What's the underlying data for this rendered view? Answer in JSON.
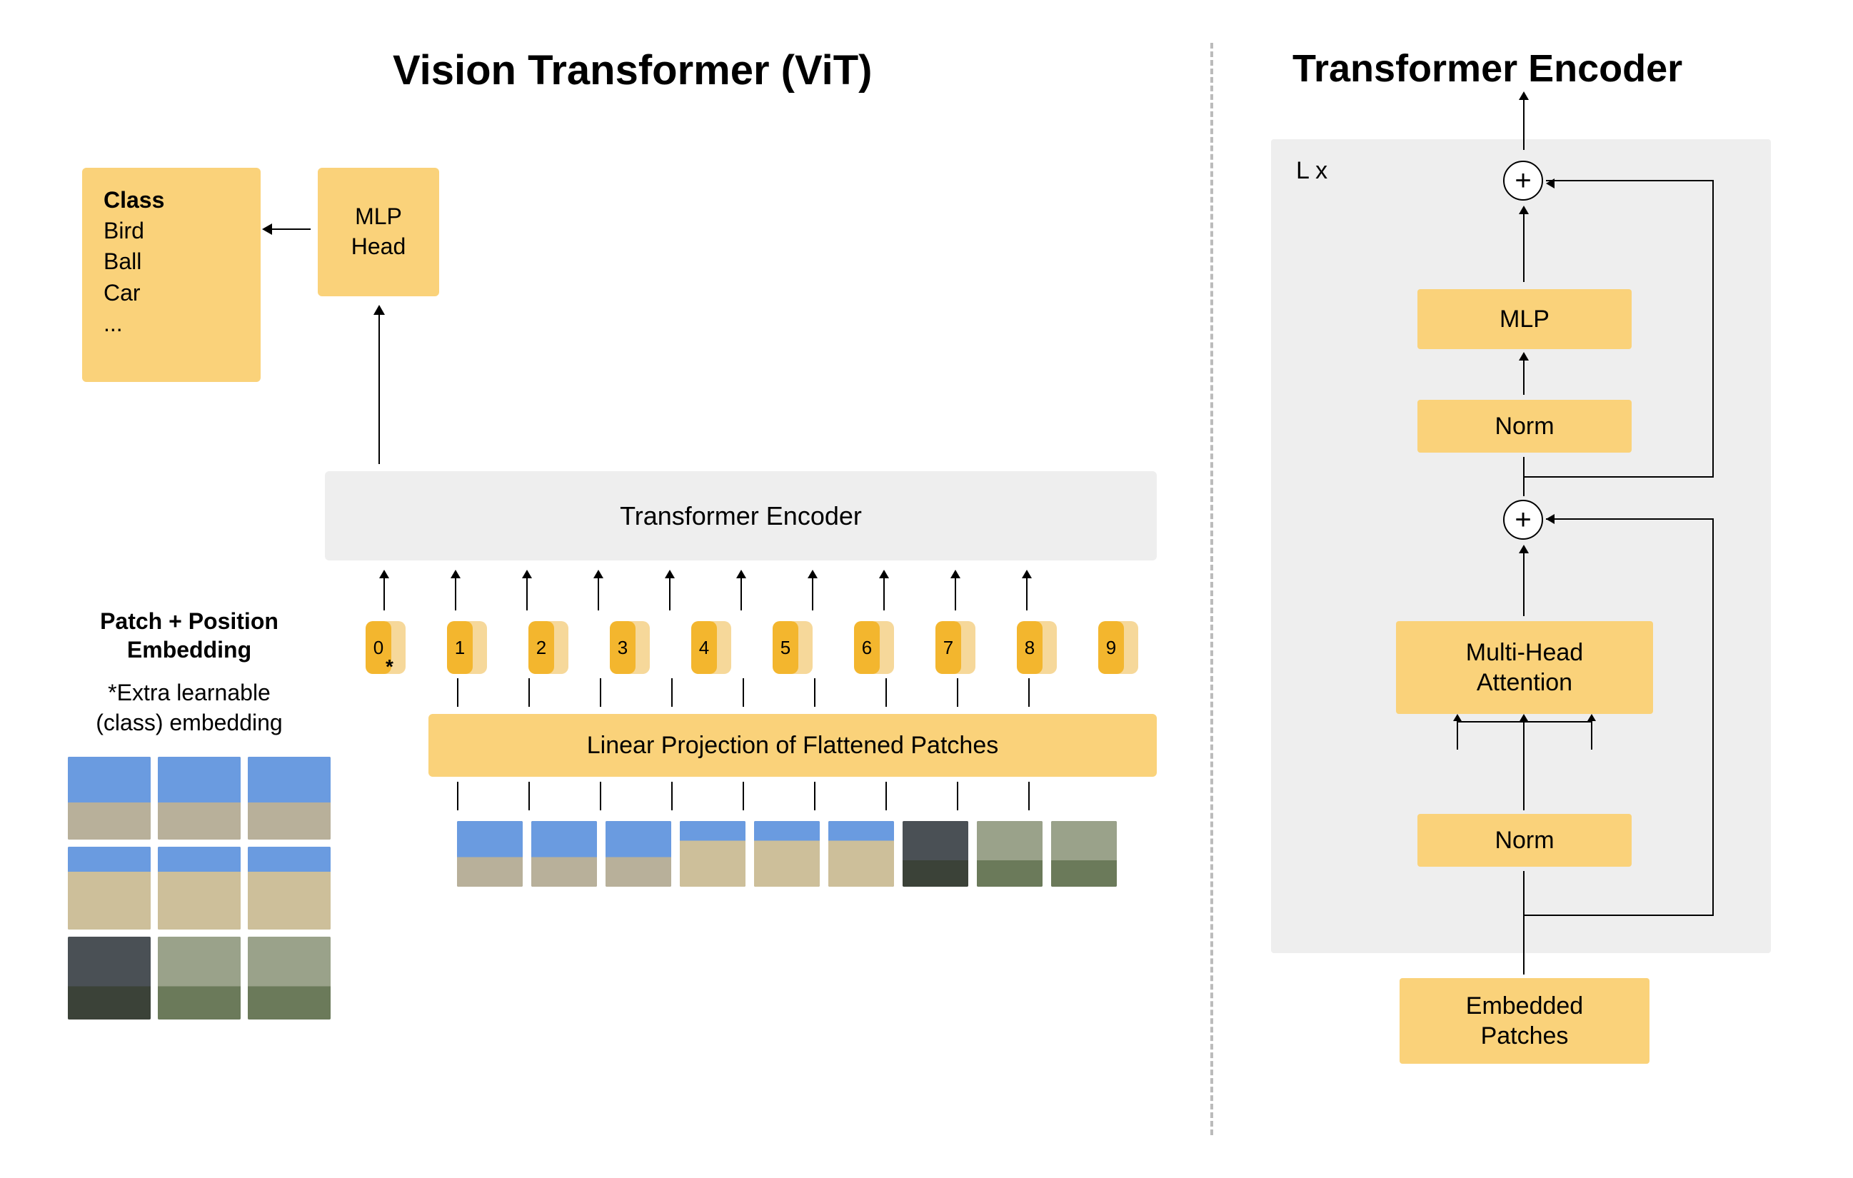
{
  "titles": {
    "left": "Vision Transformer (ViT)",
    "right": "Transformer Encoder"
  },
  "class_box": {
    "heading": "Class",
    "items": [
      "Bird",
      "Ball",
      "Car",
      "..."
    ]
  },
  "mlp_head": "MLP\nHead",
  "encoder_box": "Transformer Encoder",
  "linear_projection": "Linear Projection of Flattened Patches",
  "pp": {
    "title": "Patch + Position\nEmbedding",
    "sub": "*Extra learnable\n(class) embedding"
  },
  "positions": [
    "0",
    "1",
    "2",
    "3",
    "4",
    "5",
    "6",
    "7",
    "8",
    "9"
  ],
  "right": {
    "lx": "L x",
    "mlp": "MLP",
    "norm": "Norm",
    "mha": "Multi-Head\nAttention",
    "embedded": "Embedded\nPatches",
    "plus": "+"
  },
  "num_patches_row": 9,
  "num_patch_grid": 9
}
